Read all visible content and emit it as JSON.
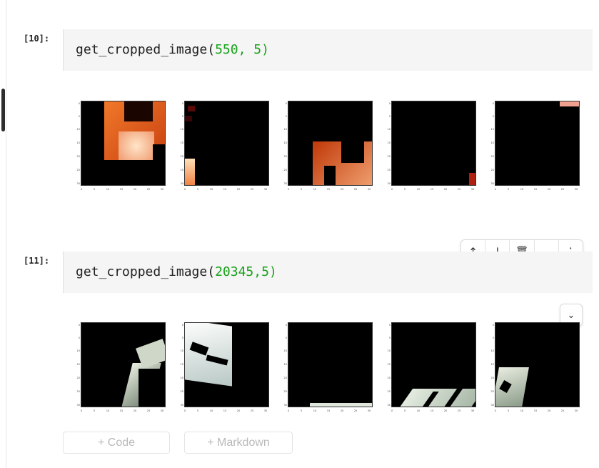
{
  "cells": [
    {
      "prompt": "[10]:",
      "code_fn": "get_cropped_image(",
      "code_args": "550, 5",
      "code_close": ")"
    },
    {
      "prompt": "[11]:",
      "code_fn": "get_cropped_image(",
      "code_args": "20345,5",
      "code_close": ")"
    }
  ],
  "plot_ticks": {
    "y": [
      "0",
      "5",
      "10",
      "15",
      "20",
      "25",
      "30"
    ],
    "x": [
      "0",
      "5",
      "10",
      "15",
      "20",
      "25",
      "30"
    ]
  },
  "toolbar": {
    "move_up": "↑",
    "move_down": "↓",
    "delete": "🗑",
    "collapse": "⌄",
    "more": "⋮"
  },
  "collapse_output": "⌄",
  "add_code_label": "+ Code",
  "add_markdown_label": "+ Markdown",
  "colors": {
    "code_bg": "#f5f5f5",
    "number_green": "#18a118",
    "plot_bg": "#000000"
  }
}
